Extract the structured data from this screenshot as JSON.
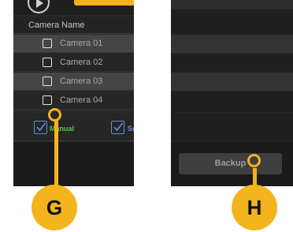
{
  "left_panel": {
    "header": "Camera Name",
    "cameras": [
      {
        "label": "Camera 01",
        "checked": false
      },
      {
        "label": "Camera 02",
        "checked": false
      },
      {
        "label": "Camera 03",
        "checked": false
      },
      {
        "label": "Camera 04",
        "checked": false
      }
    ],
    "recording": {
      "manual_label": "Manual",
      "manual_checked": true,
      "schedule_label": "Sc",
      "schedule_checked": true
    }
  },
  "right_panel": {
    "backup_label": "Backup"
  },
  "callouts": {
    "g": "G",
    "h": "H"
  },
  "colors": {
    "accent": "#f3b41c",
    "manual": "#57c457",
    "schedule": "#5d92e0"
  }
}
